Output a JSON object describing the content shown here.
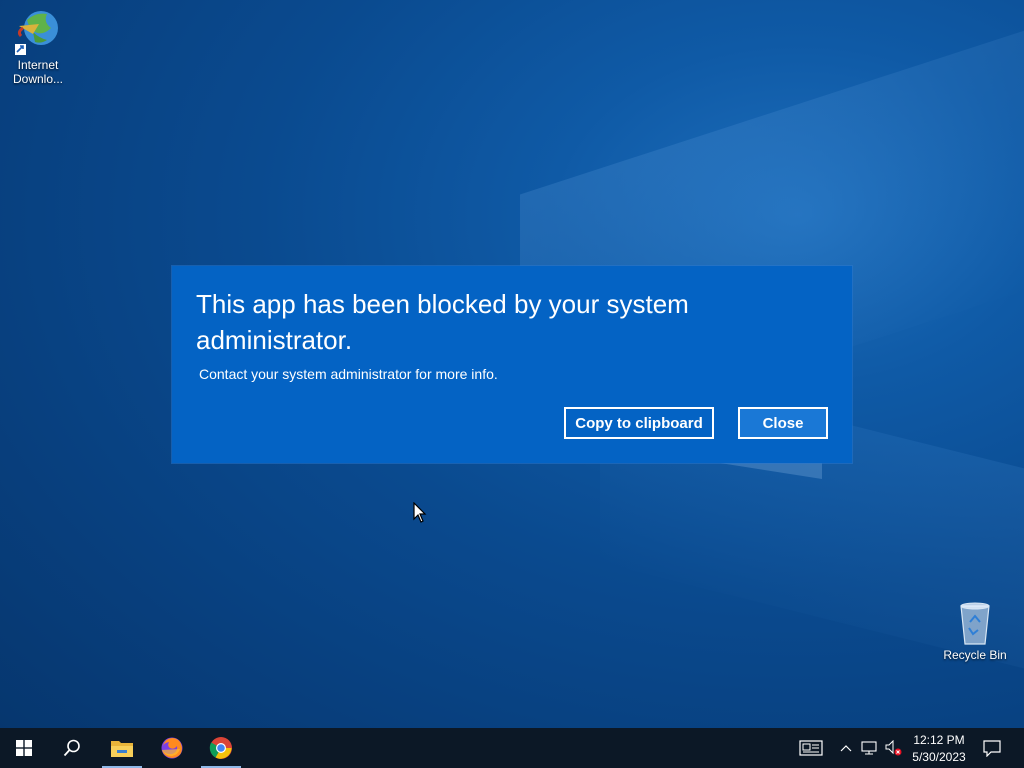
{
  "desktop": {
    "icons": [
      {
        "label": "Internet Downlo...",
        "icon": "internet-download-manager-icon"
      },
      {
        "label": "Recycle Bin",
        "icon": "recycle-bin-icon"
      }
    ]
  },
  "dialog": {
    "title": "This app has been blocked by your system administrator.",
    "message": "Contact your system administrator for more info.",
    "copy_label": "Copy to clipboard",
    "close_label": "Close",
    "background_color": "#0463c4"
  },
  "taskbar": {
    "items": [
      "windows-start-icon",
      "search-icon",
      "file-explorer-icon",
      "firefox-icon",
      "chrome-icon"
    ],
    "tray": [
      "news-and-interests-icon",
      "chevron-up-icon",
      "network-icon",
      "volume-muted-icon",
      "notification-icon"
    ],
    "clock": {
      "time": "12:12 PM",
      "date": "5/30/2023"
    }
  }
}
